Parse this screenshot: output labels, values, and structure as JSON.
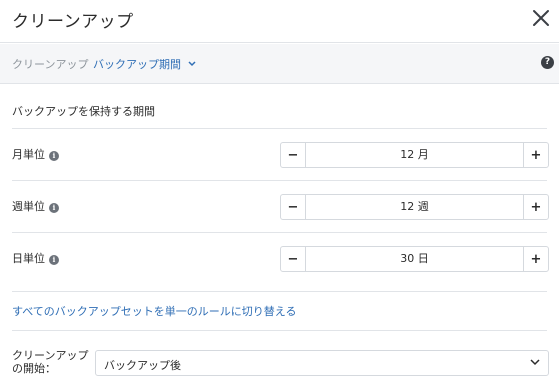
{
  "header": {
    "title": "クリーンアップ",
    "close_icon": "close-icon"
  },
  "breadcrumb": {
    "root": "クリーンアップ",
    "current": "バックアップ期間",
    "chevron_icon": "chevron-down-icon"
  },
  "help": {
    "icon": "help-icon",
    "glyph": "?"
  },
  "retention": {
    "title": "バックアップを保持する期間",
    "rows": [
      {
        "label": "月単位",
        "value": "12 月"
      },
      {
        "label": "週単位",
        "value": "12 週"
      },
      {
        "label": "日単位",
        "value": "30 日"
      }
    ],
    "minus": "−",
    "plus": "+",
    "info_glyph": "i"
  },
  "switch_rule_link": "すべてのバックアップセットを単一のルールに切り替える",
  "start": {
    "label_line1": "クリーンアップ",
    "label_line2": "の開始：",
    "selected": "バックアップ後"
  },
  "colors": {
    "link": "#2f6eb5",
    "border": "#d5d9de",
    "muted": "#8d949b"
  }
}
